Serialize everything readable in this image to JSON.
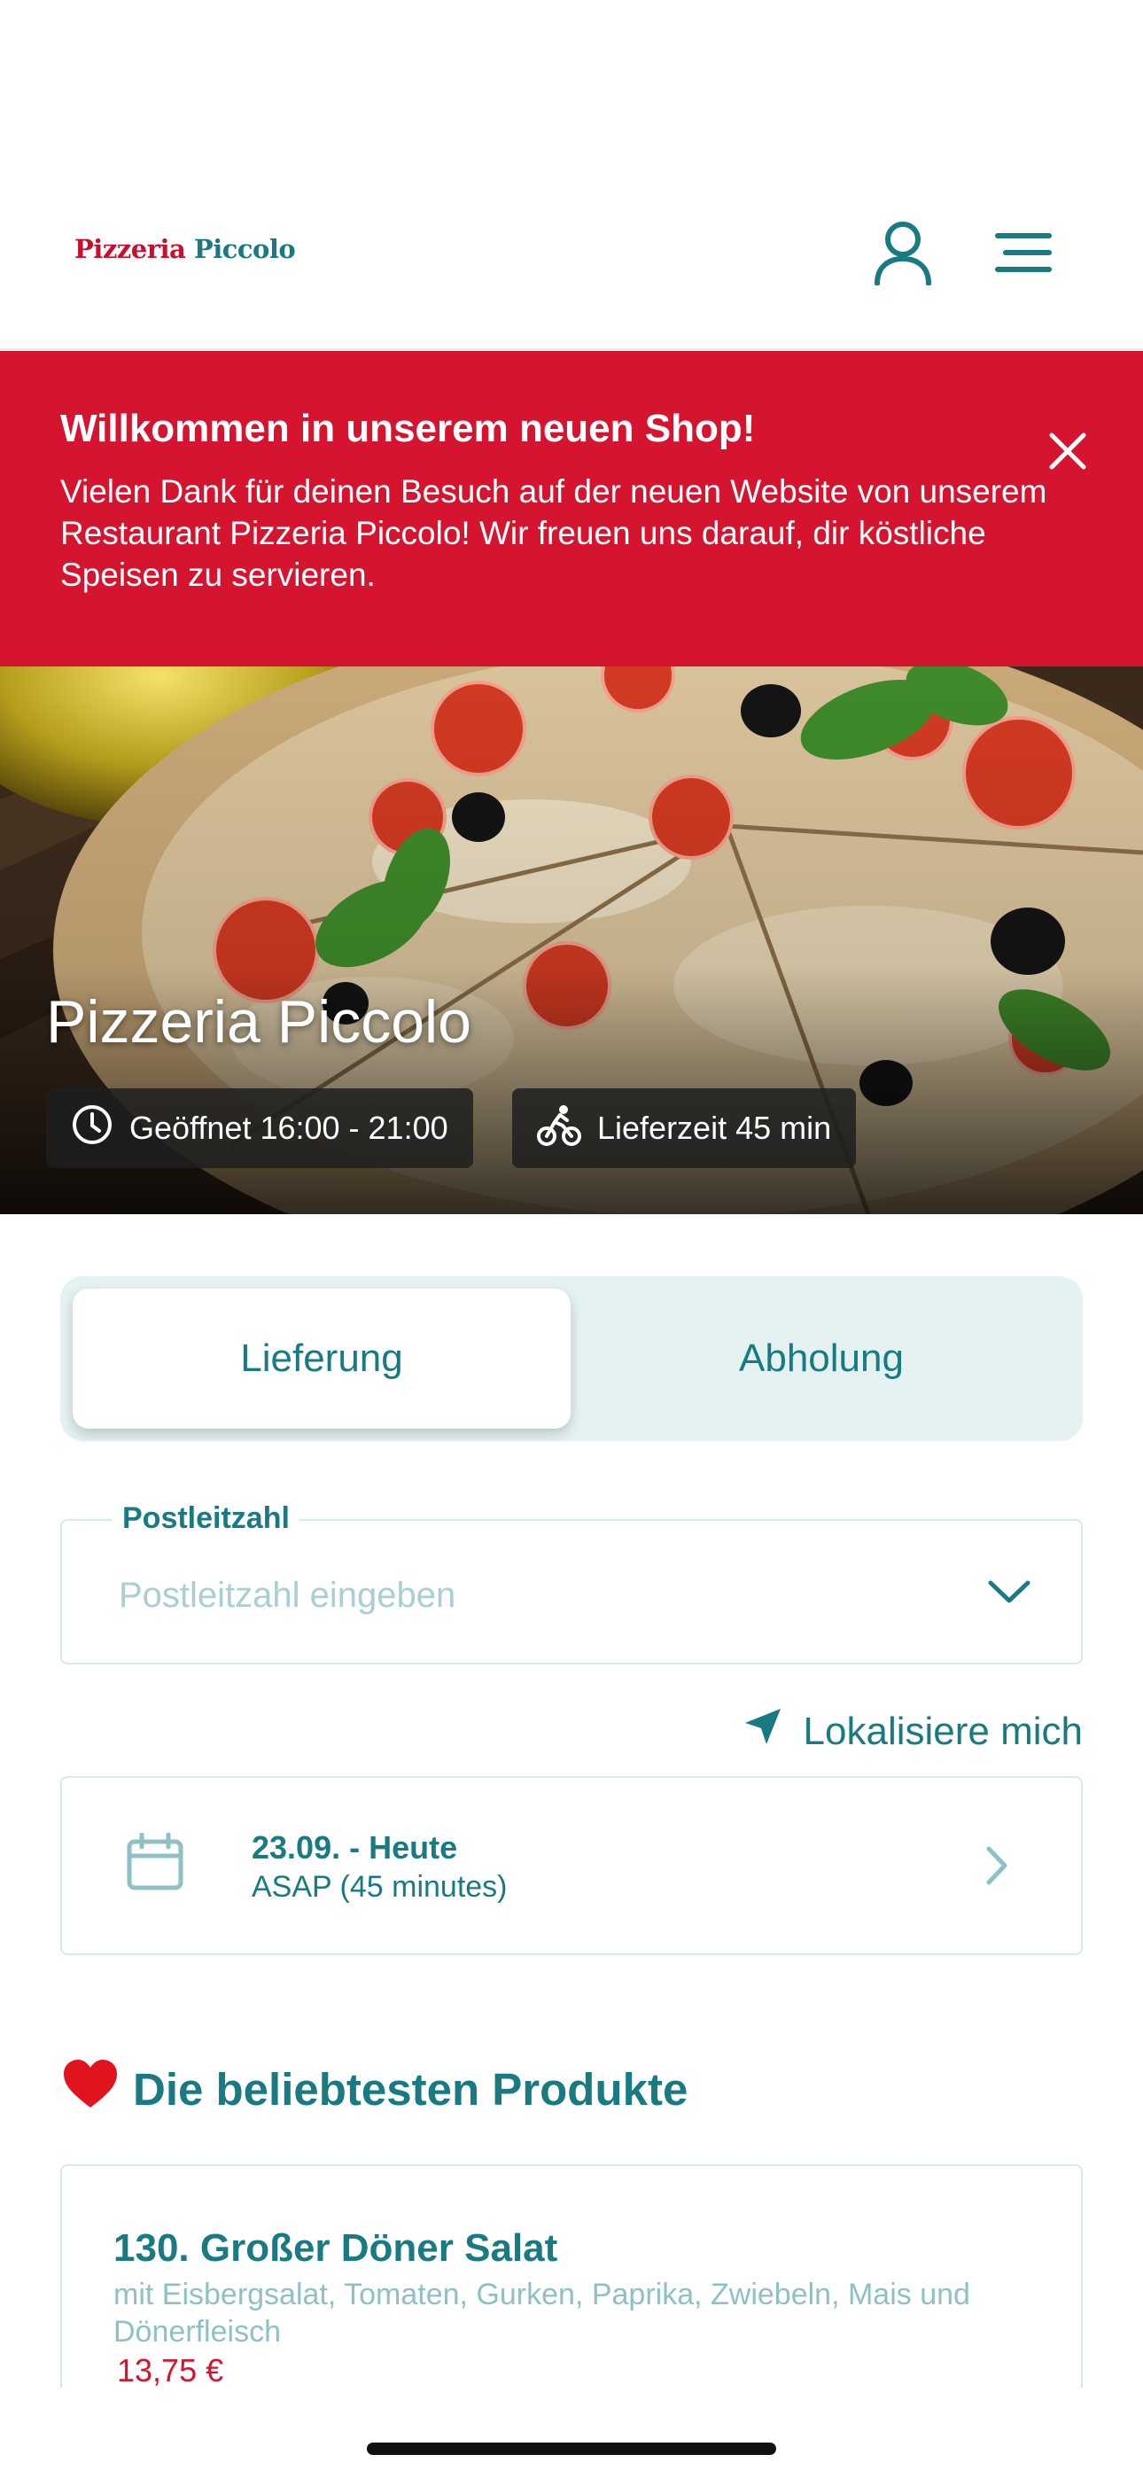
{
  "header": {
    "logo_part1": "Pizzeria",
    "logo_part2": "Piccolo",
    "user_icon": "user-icon",
    "menu_icon": "hamburger-menu-icon"
  },
  "banner": {
    "title": "Willkommen in unserem neuen Shop!",
    "text": "Vielen Dank für deinen Besuch auf der neuen Website von unserem Restaurant Pizzeria Piccolo! Wir freuen uns darauf, dir köstliche Speisen zu servieren.",
    "close_icon": "close-icon",
    "color": "#d51530"
  },
  "hero": {
    "restaurant_name": "Pizzeria Piccolo",
    "opening_hours": "Geöffnet 16:00 - 21:00",
    "delivery_time": "Lieferzeit 45 min"
  },
  "order_mode": {
    "options": [
      "Lieferung",
      "Abholung"
    ],
    "selected": "Lieferung"
  },
  "postal": {
    "label": "Postleitzahl",
    "placeholder": "Postleitzahl eingeben"
  },
  "locate": {
    "label": "Lokalisiere mich"
  },
  "schedule": {
    "date": "23.09. - Heute",
    "time": "ASAP (45 minutes)"
  },
  "popular": {
    "title": "Die beliebtesten Produkte",
    "products": [
      {
        "name": "130. Großer Döner Salat",
        "description": "mit Eisbergsalat, Tomaten, Gurken, Paprika, Zwiebeln, Mais und Dönerfleisch",
        "price": "13,75 €"
      }
    ]
  },
  "colors": {
    "primary": "#1a7a82",
    "accent_red": "#d51530",
    "toggle_bg": "#e5f2f2"
  }
}
